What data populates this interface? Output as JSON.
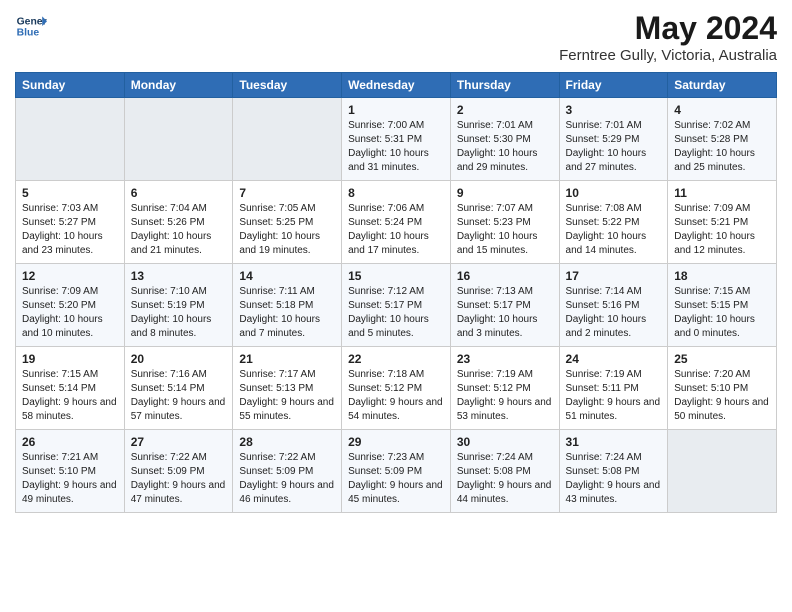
{
  "header": {
    "logo_line1": "General",
    "logo_line2": "Blue",
    "title": "May 2024",
    "subtitle": "Ferntree Gully, Victoria, Australia"
  },
  "days_of_week": [
    "Sunday",
    "Monday",
    "Tuesday",
    "Wednesday",
    "Thursday",
    "Friday",
    "Saturday"
  ],
  "weeks": [
    [
      {
        "day": "",
        "empty": true
      },
      {
        "day": "",
        "empty": true
      },
      {
        "day": "",
        "empty": true
      },
      {
        "day": "1",
        "sunrise": "7:00 AM",
        "sunset": "5:31 PM",
        "daylight": "10 hours and 31 minutes."
      },
      {
        "day": "2",
        "sunrise": "7:01 AM",
        "sunset": "5:30 PM",
        "daylight": "10 hours and 29 minutes."
      },
      {
        "day": "3",
        "sunrise": "7:01 AM",
        "sunset": "5:29 PM",
        "daylight": "10 hours and 27 minutes."
      },
      {
        "day": "4",
        "sunrise": "7:02 AM",
        "sunset": "5:28 PM",
        "daylight": "10 hours and 25 minutes."
      }
    ],
    [
      {
        "day": "5",
        "sunrise": "7:03 AM",
        "sunset": "5:27 PM",
        "daylight": "10 hours and 23 minutes."
      },
      {
        "day": "6",
        "sunrise": "7:04 AM",
        "sunset": "5:26 PM",
        "daylight": "10 hours and 21 minutes."
      },
      {
        "day": "7",
        "sunrise": "7:05 AM",
        "sunset": "5:25 PM",
        "daylight": "10 hours and 19 minutes."
      },
      {
        "day": "8",
        "sunrise": "7:06 AM",
        "sunset": "5:24 PM",
        "daylight": "10 hours and 17 minutes."
      },
      {
        "day": "9",
        "sunrise": "7:07 AM",
        "sunset": "5:23 PM",
        "daylight": "10 hours and 15 minutes."
      },
      {
        "day": "10",
        "sunrise": "7:08 AM",
        "sunset": "5:22 PM",
        "daylight": "10 hours and 14 minutes."
      },
      {
        "day": "11",
        "sunrise": "7:09 AM",
        "sunset": "5:21 PM",
        "daylight": "10 hours and 12 minutes."
      }
    ],
    [
      {
        "day": "12",
        "sunrise": "7:09 AM",
        "sunset": "5:20 PM",
        "daylight": "10 hours and 10 minutes."
      },
      {
        "day": "13",
        "sunrise": "7:10 AM",
        "sunset": "5:19 PM",
        "daylight": "10 hours and 8 minutes."
      },
      {
        "day": "14",
        "sunrise": "7:11 AM",
        "sunset": "5:18 PM",
        "daylight": "10 hours and 7 minutes."
      },
      {
        "day": "15",
        "sunrise": "7:12 AM",
        "sunset": "5:17 PM",
        "daylight": "10 hours and 5 minutes."
      },
      {
        "day": "16",
        "sunrise": "7:13 AM",
        "sunset": "5:17 PM",
        "daylight": "10 hours and 3 minutes."
      },
      {
        "day": "17",
        "sunrise": "7:14 AM",
        "sunset": "5:16 PM",
        "daylight": "10 hours and 2 minutes."
      },
      {
        "day": "18",
        "sunrise": "7:15 AM",
        "sunset": "5:15 PM",
        "daylight": "10 hours and 0 minutes."
      }
    ],
    [
      {
        "day": "19",
        "sunrise": "7:15 AM",
        "sunset": "5:14 PM",
        "daylight": "9 hours and 58 minutes."
      },
      {
        "day": "20",
        "sunrise": "7:16 AM",
        "sunset": "5:14 PM",
        "daylight": "9 hours and 57 minutes."
      },
      {
        "day": "21",
        "sunrise": "7:17 AM",
        "sunset": "5:13 PM",
        "daylight": "9 hours and 55 minutes."
      },
      {
        "day": "22",
        "sunrise": "7:18 AM",
        "sunset": "5:12 PM",
        "daylight": "9 hours and 54 minutes."
      },
      {
        "day": "23",
        "sunrise": "7:19 AM",
        "sunset": "5:12 PM",
        "daylight": "9 hours and 53 minutes."
      },
      {
        "day": "24",
        "sunrise": "7:19 AM",
        "sunset": "5:11 PM",
        "daylight": "9 hours and 51 minutes."
      },
      {
        "day": "25",
        "sunrise": "7:20 AM",
        "sunset": "5:10 PM",
        "daylight": "9 hours and 50 minutes."
      }
    ],
    [
      {
        "day": "26",
        "sunrise": "7:21 AM",
        "sunset": "5:10 PM",
        "daylight": "9 hours and 49 minutes."
      },
      {
        "day": "27",
        "sunrise": "7:22 AM",
        "sunset": "5:09 PM",
        "daylight": "9 hours and 47 minutes."
      },
      {
        "day": "28",
        "sunrise": "7:22 AM",
        "sunset": "5:09 PM",
        "daylight": "9 hours and 46 minutes."
      },
      {
        "day": "29",
        "sunrise": "7:23 AM",
        "sunset": "5:09 PM",
        "daylight": "9 hours and 45 minutes."
      },
      {
        "day": "30",
        "sunrise": "7:24 AM",
        "sunset": "5:08 PM",
        "daylight": "9 hours and 44 minutes."
      },
      {
        "day": "31",
        "sunrise": "7:24 AM",
        "sunset": "5:08 PM",
        "daylight": "9 hours and 43 minutes."
      },
      {
        "day": "",
        "empty": true
      }
    ]
  ]
}
